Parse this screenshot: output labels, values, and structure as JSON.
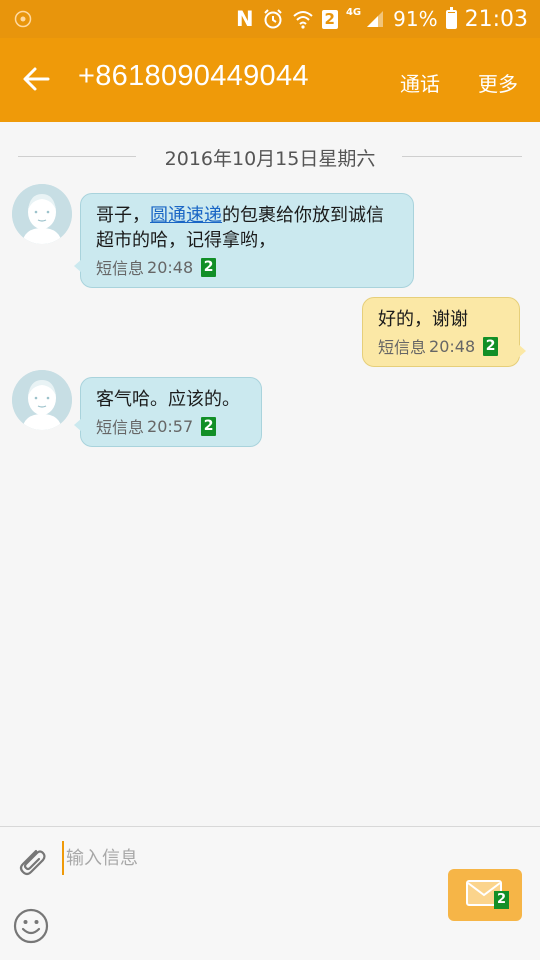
{
  "status_bar": {
    "network_glyph": "N",
    "sim_slot": "2",
    "network_type": "4G",
    "battery_percent": "91%",
    "battery_level": 0.91,
    "time": "21:03",
    "icons": [
      "samsung-account-icon",
      "nfc-icon",
      "alarm-icon",
      "wifi-icon",
      "signal-icon",
      "battery-icon"
    ]
  },
  "app_bar": {
    "title": "+8618090449044",
    "call_label": "通话",
    "more_label": "更多",
    "back_icon": "back-arrow-icon",
    "color": "#ef9a09"
  },
  "conversation": {
    "date": "2016年10月15日星期六",
    "messages": [
      {
        "direction": "incoming",
        "text_before": "哥子，",
        "link": "圆通速递",
        "text_after": "的包裹给你放到诚信超市的哈，记得拿哟，",
        "type_label": "短信息",
        "time": "20:48",
        "sim": "2"
      },
      {
        "direction": "outgoing",
        "text": "好的，谢谢",
        "type_label": "短信息",
        "time": "20:48",
        "sim": "2"
      },
      {
        "direction": "incoming",
        "text": "客气哈。应该的。",
        "type_label": "短信息",
        "time": "20:57",
        "sim": "2"
      }
    ]
  },
  "composer": {
    "placeholder": "输入信息",
    "value": "",
    "send_sim": "2",
    "attach_icon": "paperclip-icon",
    "emoji_icon": "smiley-icon",
    "send_icon": "envelope-icon"
  },
  "colors": {
    "accent": "#ef9a09",
    "incoming_bubble": "#cbe9ef",
    "outgoing_bubble": "#fbe8a6",
    "sim_badge": "#128f27",
    "link": "#1a66c5"
  }
}
